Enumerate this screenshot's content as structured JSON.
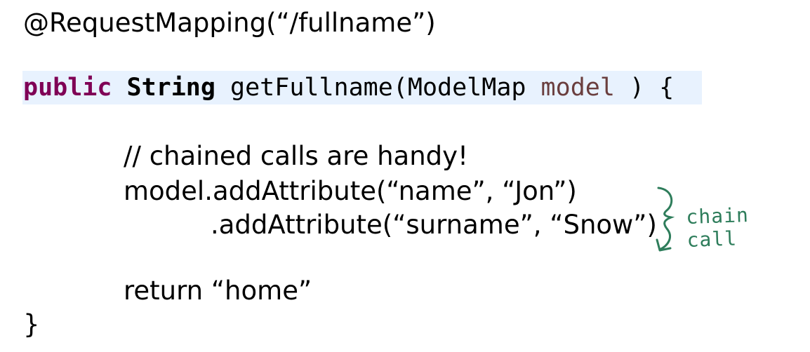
{
  "code": {
    "annotation": "@RequestMapping(“/fullname”)",
    "signature": {
      "keyword": "public",
      "return_type": "String",
      "method_open": "getFullname(ModelMap",
      "param_name": "model",
      "method_close": ") {"
    },
    "comment": "// chained calls are handy!",
    "chain_line_1": "model.addAttribute(“name”, “Jon”)",
    "chain_line_2": ".addAttribute(“surname”, “Snow”)",
    "return_line": "return “home”",
    "closing_brace": "}"
  },
  "handwritten_note": {
    "text": "chain call",
    "color": "#2e7d5b"
  },
  "colors": {
    "keyword": "#7f0055",
    "param": "#6a3e3e",
    "highlight": "#e8f2fe"
  }
}
